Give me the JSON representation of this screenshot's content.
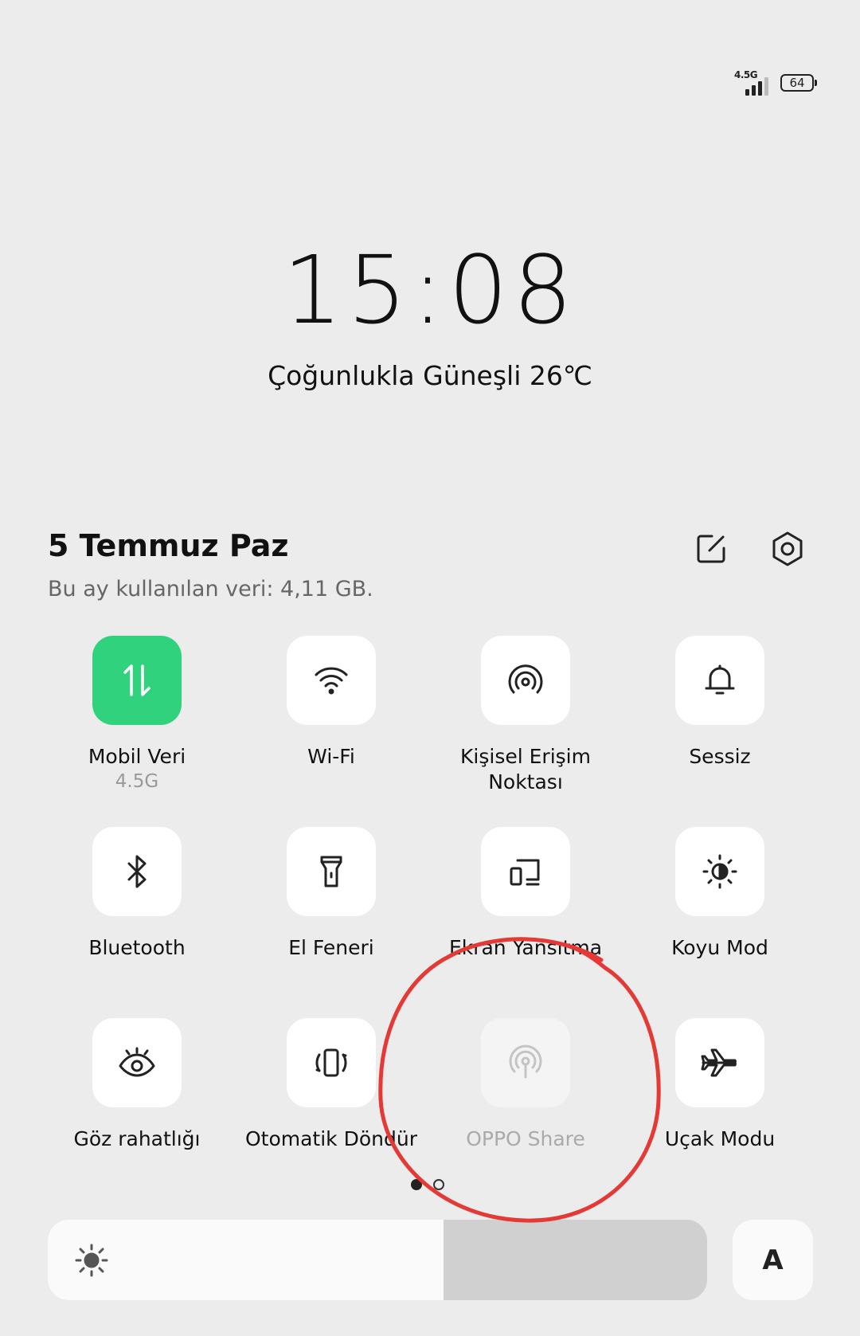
{
  "status_bar": {
    "network": "4.5G",
    "battery": "64"
  },
  "lockscreen": {
    "time": "15:08",
    "weather": "Çoğunlukla Güneşli 26℃"
  },
  "panel": {
    "date": "5 Temmuz Paz",
    "data_usage": "Bu ay kullanılan veri: 4,11 GB."
  },
  "tiles": [
    {
      "label": "Mobil Veri",
      "sub": "4.5G",
      "icon": "mobile-data-icon",
      "state": "active"
    },
    {
      "label": "Wi-Fi",
      "icon": "wifi-icon",
      "state": "off"
    },
    {
      "label": "Kişisel Erişim Noktası",
      "icon": "hotspot-icon",
      "state": "off"
    },
    {
      "label": "Sessiz",
      "icon": "bell-icon",
      "state": "off"
    },
    {
      "label": "Bluetooth",
      "icon": "bluetooth-icon",
      "state": "off"
    },
    {
      "label": "El Feneri",
      "icon": "flashlight-icon",
      "state": "off"
    },
    {
      "label": "Ekran Yansıtma",
      "icon": "screen-cast-icon",
      "state": "off"
    },
    {
      "label": "Koyu Mod",
      "icon": "dark-mode-icon",
      "state": "off"
    },
    {
      "label": "Göz rahatlığı",
      "icon": "eye-comfort-icon",
      "state": "off"
    },
    {
      "label": "Otomatik Döndür",
      "icon": "auto-rotate-icon",
      "state": "off"
    },
    {
      "label": "OPPO Share",
      "icon": "oppo-share-icon",
      "state": "disabled"
    },
    {
      "label": "Uçak Modu",
      "icon": "airplane-icon",
      "state": "off"
    }
  ],
  "pager": {
    "pages": 2,
    "current": 1
  },
  "brightness": {
    "level": 0.6,
    "auto_label": "A"
  },
  "colors": {
    "background": "#ececec",
    "tile": "#ffffff",
    "tile_active": "#30d27e",
    "annotation": "#e53935"
  }
}
